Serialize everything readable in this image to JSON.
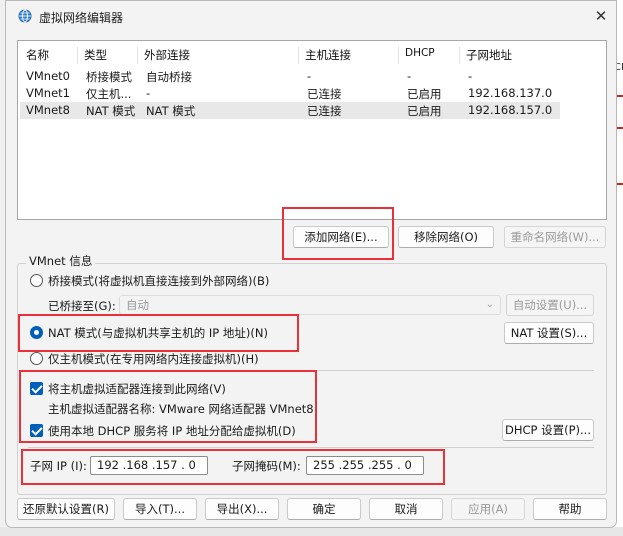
{
  "window": {
    "title": "虚拟网络编辑器",
    "close_glyph": "✕"
  },
  "table": {
    "columns": [
      "名称",
      "类型",
      "外部连接",
      "主机连接",
      "DHCP",
      "子网地址"
    ],
    "rows": [
      {
        "name": "VMnet0",
        "type": "桥接模式",
        "external": "自动桥接",
        "host": "-",
        "dhcp": "-",
        "subnet": "-"
      },
      {
        "name": "VMnet1",
        "type": "仅主机...",
        "external": "-",
        "host": "已连接",
        "dhcp": "已启用",
        "subnet": "192.168.137.0"
      },
      {
        "name": "VMnet8",
        "type": "NAT 模式",
        "external": "NAT 模式",
        "host": "已连接",
        "dhcp": "已启用",
        "subnet": "192.168.157.0",
        "selected": true
      }
    ]
  },
  "table_buttons": {
    "add": "添加网络(E)...",
    "remove": "移除网络(O)",
    "rename": "重命名网络(W)..."
  },
  "vmnet_info": {
    "group_title": "VMnet 信息",
    "bridge_radio": "桥接模式(将虚拟机直接连接到外部网络)(B)",
    "bridged_to_label": "已桥接至(G):",
    "bridged_to_value": "自动",
    "auto_settings": "自动设置(U)...",
    "nat_radio": "NAT 模式(与虚拟机共享主机的 IP 地址)(N)",
    "nat_settings": "NAT 设置(S)...",
    "hostonly_radio": "仅主机模式(在专用网络内连接虚拟机)(H)",
    "connect_adapter_check": "将主机虚拟适配器连接到此网络(V)",
    "adapter_name_label": "主机虚拟适配器名称: VMware 网络适配器 VMnet8",
    "dhcp_check": "使用本地 DHCP 服务将 IP 地址分配给虚拟机(D)",
    "dhcp_settings": "DHCP 设置(P)...",
    "subnet_ip_label": "子网 IP (I):",
    "subnet_ip_value": "192 .168 .157 . 0",
    "subnet_mask_label": "子网掩码(M):",
    "subnet_mask_value": "255 .255 .255 . 0",
    "selected_mode": "nat"
  },
  "footer_buttons": {
    "restore": "还原默认设置(R)",
    "import": "导入(T)...",
    "export": "导出(X)...",
    "ok": "确定",
    "cancel": "取消",
    "apply": "应用(A)",
    "help": "帮助"
  },
  "background_text": [
    "CF",
    "(W)...",
    "』"
  ],
  "colors": {
    "accent": "#005fb8",
    "annotation": "#e8313a",
    "selected_row": "#e8e8e8"
  },
  "icons": {
    "app": "globe-network-icon",
    "close": "close-icon",
    "dropdown": "chevron-down-icon"
  }
}
